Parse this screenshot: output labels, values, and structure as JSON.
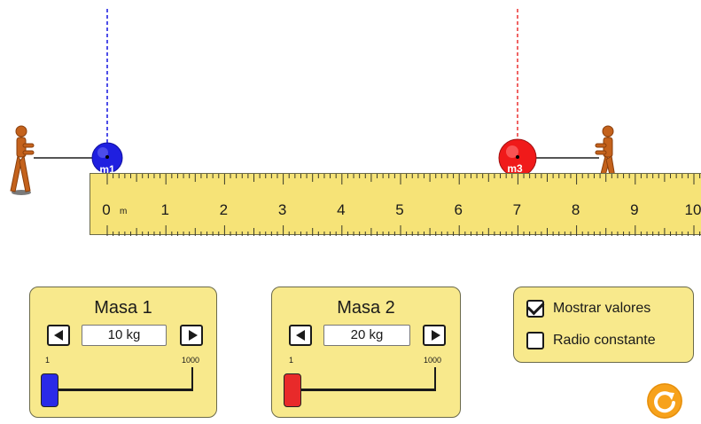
{
  "simulation": {
    "masses": [
      {
        "label": "m1",
        "color": "#1f1fe0",
        "dashed_line_color": "#4e4ee8"
      },
      {
        "label": "m3",
        "color": "#f01a1a",
        "dashed_line_color": "#f06464"
      }
    ]
  },
  "ruler": {
    "labels": [
      "0",
      "1",
      "2",
      "3",
      "4",
      "5",
      "6",
      "7",
      "8",
      "9",
      "10"
    ],
    "unit": "m",
    "color": "#f6e377"
  },
  "panel_mass1": {
    "title": "Masa 1",
    "value": "10 kg",
    "min_label": "1",
    "max_label": "1000",
    "slider_fraction": 0.01,
    "thumb_color": "#2a2ae8"
  },
  "panel_mass2": {
    "title": "Masa 2",
    "value": "20 kg",
    "min_label": "1",
    "max_label": "1000",
    "slider_fraction": 0.02,
    "thumb_color": "#e82a2a"
  },
  "options": {
    "show_values": {
      "label": "Mostrar valores",
      "checked": true
    },
    "constant_radius": {
      "label": "Radio constante",
      "checked": false
    }
  },
  "controls": {
    "reset_icon": "reset-icon",
    "reset_color": "#f7a21b"
  }
}
